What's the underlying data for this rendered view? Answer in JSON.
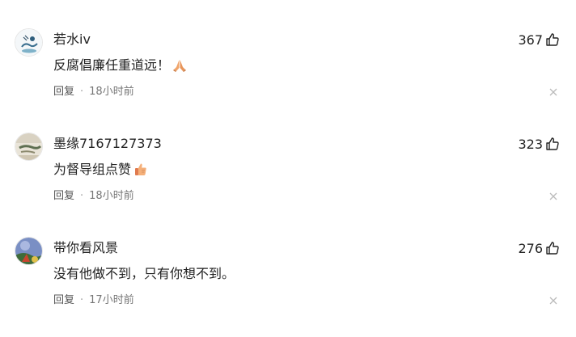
{
  "comments": [
    {
      "username": "若水iv",
      "likes": "367",
      "content": "反腐倡廉任重道远！",
      "emoji": "folded-hands-emoji",
      "reply_label": "回复",
      "separator": "·",
      "time": "18小时前"
    },
    {
      "username": "墨缘7167127373",
      "likes": "323",
      "content": "为督导组点赞",
      "emoji": "thumbs-up-emoji",
      "reply_label": "回复",
      "separator": "·",
      "time": "18小时前"
    },
    {
      "username": "带你看风景",
      "likes": "276",
      "content": "没有他做不到，只有你想不到。",
      "emoji": "",
      "reply_label": "回复",
      "separator": "·",
      "time": "17小时前"
    }
  ],
  "icons": {
    "like": "thumb-up-outline-icon",
    "close": "close-icon"
  },
  "colors": {
    "text": "#222222",
    "meta": "#777777",
    "close": "#bbbbbb"
  }
}
